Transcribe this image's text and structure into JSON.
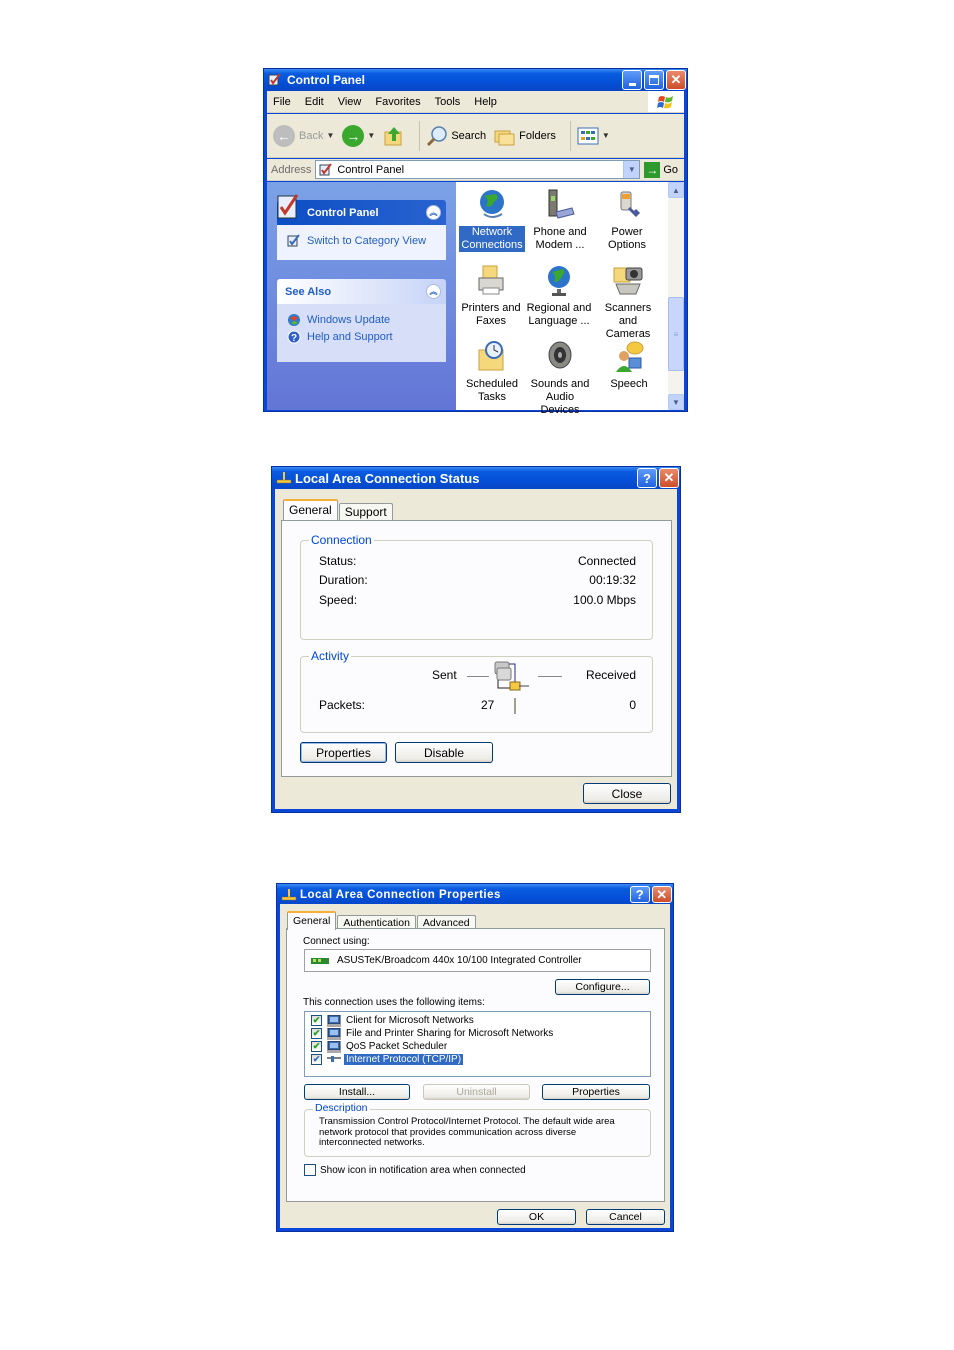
{
  "control_panel": {
    "title": "Control Panel",
    "window_buttons": {
      "minimize": "_",
      "maximize": "□",
      "close": "✕"
    },
    "menu": [
      "File",
      "Edit",
      "View",
      "Favorites",
      "Tools",
      "Help"
    ],
    "toolbar": {
      "back": "Back",
      "search": "Search",
      "folders": "Folders"
    },
    "address": {
      "label": "Address",
      "value": "Control Panel",
      "go": "Go"
    },
    "task_pane": {
      "title": "Control Panel",
      "switch_link": "Switch to Category View",
      "see_also_title": "See Also",
      "see_also_links": [
        "Windows Update",
        "Help and Support"
      ]
    },
    "items": [
      {
        "label": "Network Connections",
        "line1": "Network",
        "line2": "Connections",
        "icon": "network-connections-icon",
        "selected": true
      },
      {
        "label": "Phone and Modem ...",
        "line1": "Phone and",
        "line2": "Modem ...",
        "icon": "phone-modem-icon"
      },
      {
        "label": "Power Options",
        "line1": "Power Options",
        "line2": "",
        "icon": "power-options-icon"
      },
      {
        "label": "Printers and Faxes",
        "line1": "Printers and",
        "line2": "Faxes",
        "icon": "printer-icon"
      },
      {
        "label": "Regional and Language ...",
        "line1": "Regional and",
        "line2": "Language ...",
        "icon": "globe-icon"
      },
      {
        "label": "Scanners and Cameras",
        "line1": "Scanners and",
        "line2": "Cameras",
        "icon": "scanner-camera-icon"
      },
      {
        "label": "Scheduled Tasks",
        "line1": "Scheduled",
        "line2": "Tasks",
        "icon": "scheduled-tasks-icon"
      },
      {
        "label": "Sounds and Audio Devices",
        "line1": "Sounds and",
        "line2": "Audio Devices",
        "icon": "speaker-icon"
      },
      {
        "label": "Speech",
        "line1": "Speech",
        "line2": "",
        "icon": "speech-icon"
      }
    ]
  },
  "status_dialog": {
    "title": "Local Area Connection Status",
    "tabs": [
      "General",
      "Support"
    ],
    "active_tab": "General",
    "connection": {
      "legend": "Connection",
      "rows": [
        {
          "label": "Status:",
          "value": "Connected"
        },
        {
          "label": "Duration:",
          "value": "00:19:32"
        },
        {
          "label": "Speed:",
          "value": "100.0 Mbps"
        }
      ]
    },
    "activity": {
      "legend": "Activity",
      "sent_label": "Sent",
      "received_label": "Received",
      "packets_label": "Packets:",
      "sent": "27",
      "received": "0"
    },
    "buttons": {
      "properties": "Properties",
      "disable": "Disable",
      "close": "Close"
    }
  },
  "properties_dialog": {
    "title": "Local Area Connection Properties",
    "tabs": [
      "General",
      "Authentication",
      "Advanced"
    ],
    "active_tab": "General",
    "connect_using_label": "Connect using:",
    "adapter": "ASUSTeK/Broadcom 440x 10/100 Integrated Controller",
    "configure": "Configure...",
    "items_label": "This connection uses the following items:",
    "items": [
      {
        "label": "Client for Microsoft Networks",
        "checked": true
      },
      {
        "label": "File and Printer Sharing for Microsoft Networks",
        "checked": true
      },
      {
        "label": "QoS Packet Scheduler",
        "checked": true
      },
      {
        "label": "Internet Protocol (TCP/IP)",
        "checked": true,
        "selected": true
      }
    ],
    "buttons": {
      "install": "Install...",
      "uninstall": "Uninstall",
      "properties": "Properties",
      "ok": "OK",
      "cancel": "Cancel"
    },
    "description": {
      "legend": "Description",
      "text": "Transmission Control Protocol/Internet Protocol. The default wide area network protocol that provides communication across diverse interconnected networks."
    },
    "show_icon_label": "Show icon in notification area when connected",
    "show_icon_checked": false
  }
}
